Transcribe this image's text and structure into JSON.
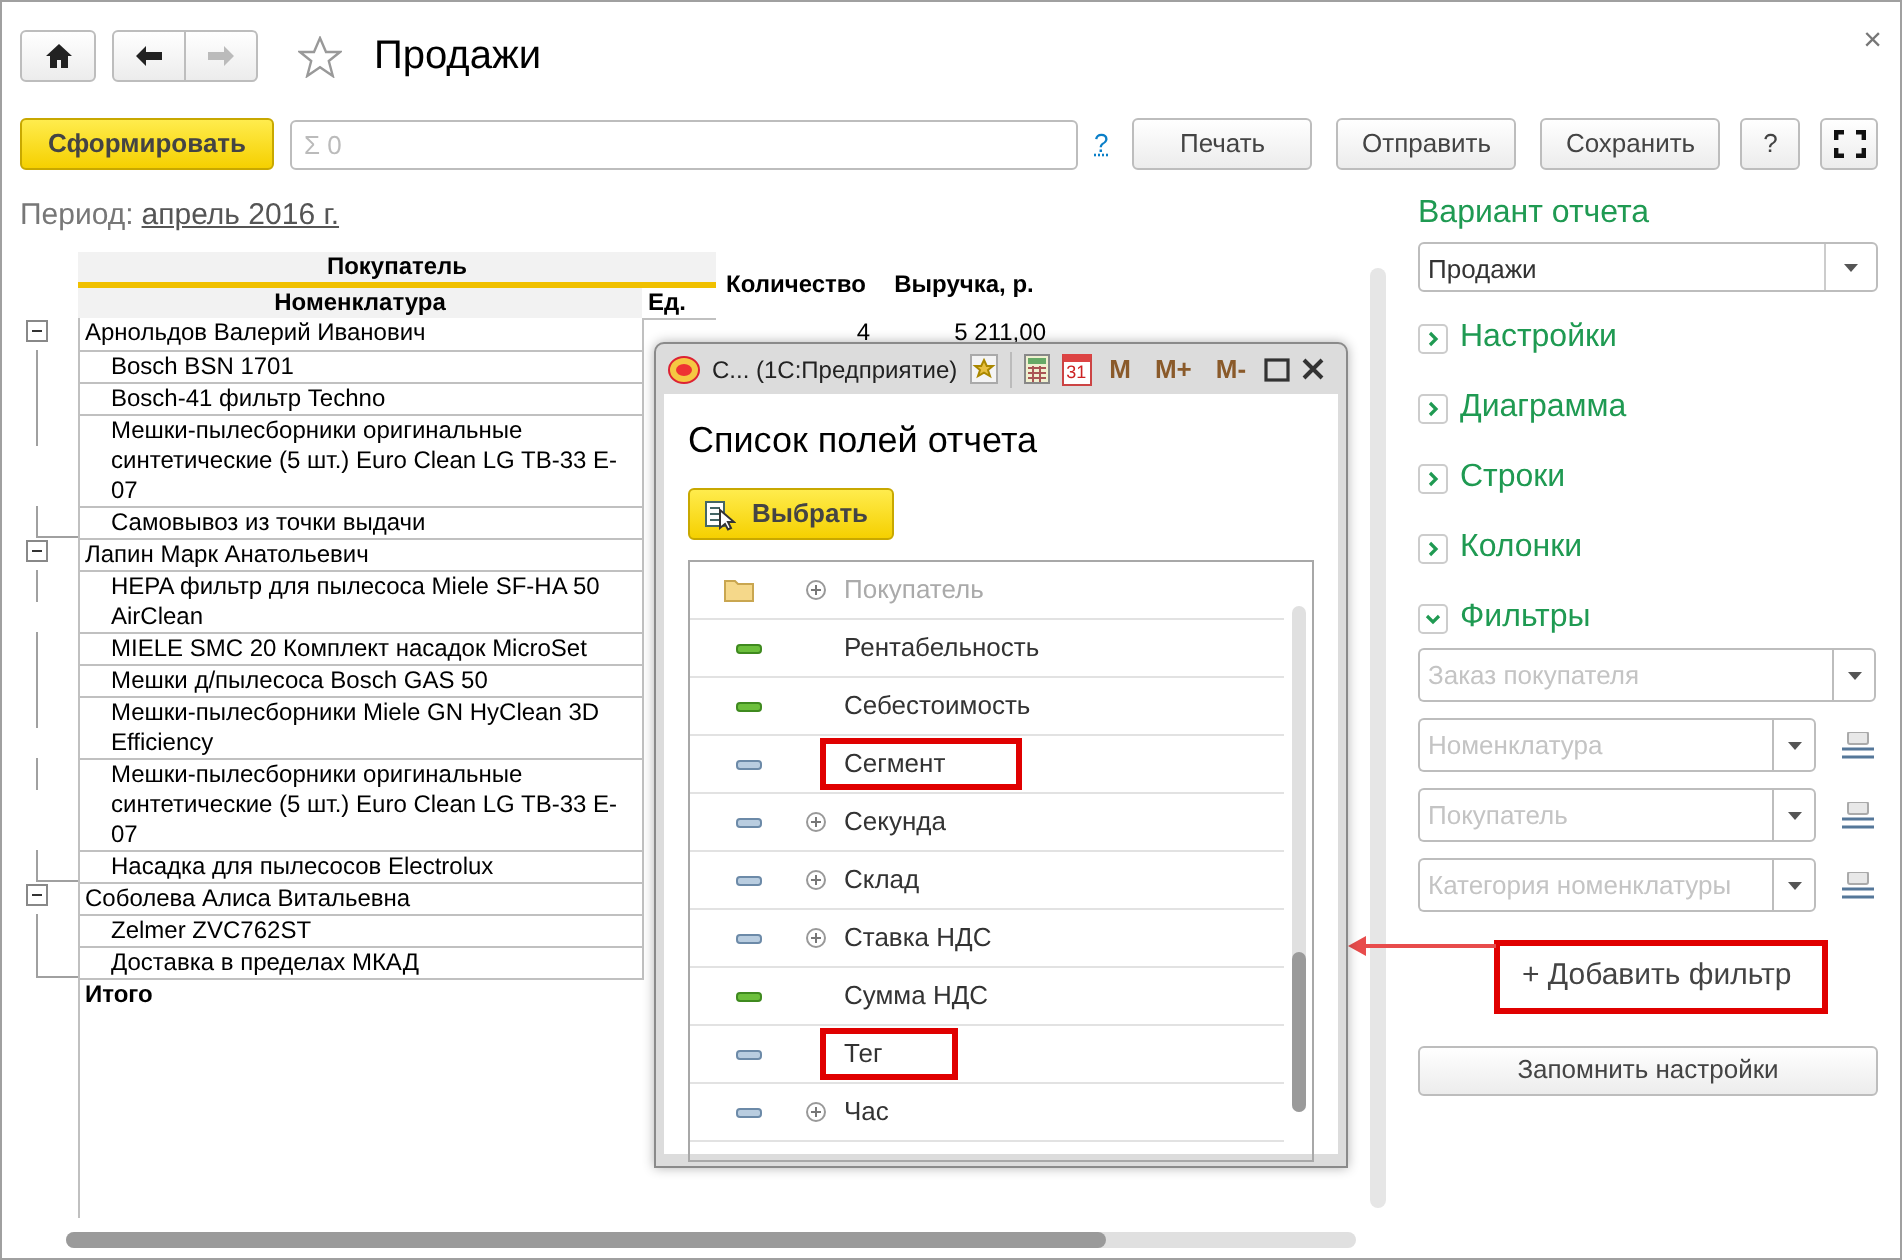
{
  "nav": {
    "back_disabled": false,
    "forward_disabled": true
  },
  "page": {
    "title": "Продажи",
    "favorite": false,
    "close_button": "×"
  },
  "toolbar": {
    "generate_button": "Сформировать",
    "search": {
      "placeholder": "Σ 0"
    },
    "help_link": "?",
    "buttons": [
      "Печать",
      "Отправить",
      "Сохранить"
    ],
    "help_button": "?"
  },
  "period": {
    "label": "Период:",
    "value": "апрель 2016 г."
  },
  "report": {
    "header": {
      "group": "Покупатель",
      "item": "Номенклатура",
      "unit": "Ед.",
      "quantity": "Количество",
      "revenue": "Выручка, р."
    },
    "groups": [
      {
        "name": "Арнольдов Валерий Иванович",
        "expanded": true,
        "quantity": "4",
        "revenue": "5 211,00",
        "children": [
          {
            "name": "Bosch BSN 1701"
          },
          {
            "name": "Bosch-41 фильтр Techno"
          },
          {
            "name": "Мешки-пылесборники оригинальные синтетические (5 шт.) Euro Clean LG TB-33 E-07"
          },
          {
            "name": "Самовывоз из точки выдачи"
          }
        ]
      },
      {
        "name": "Лапин Марк Анатольевич",
        "expanded": true,
        "children": [
          {
            "name": "HEPA фильтр для пылесоса Miele SF-HA 50 AirClean"
          },
          {
            "name": "MIELE SMC 20 Комплект насадок MicroSet"
          },
          {
            "name": "Мешки д/пылесоса Bosch GAS 50"
          },
          {
            "name": "Мешки-пылесборники Miele GN HyClean 3D Efficiency"
          },
          {
            "name": "Мешки-пылесборники оригинальные синтетические (5 шт.) Euro Clean LG TB-33 E-07"
          },
          {
            "name": "Насадка для пылесосов Electrolux"
          }
        ]
      },
      {
        "name": "Соболева Алиса Витальевна",
        "expanded": true,
        "children": [
          {
            "name": "Zelmer ZVC762ST"
          },
          {
            "name": "Доставка в пределах МКАД"
          }
        ]
      }
    ],
    "total": "Итого"
  },
  "settings_panel": {
    "variant_label": "Вариант отчета",
    "variant_value": "Продажи",
    "sections": [
      {
        "label": "Настройки",
        "expanded": false
      },
      {
        "label": "Диаграмма",
        "expanded": false
      },
      {
        "label": "Строки",
        "expanded": false
      },
      {
        "label": "Колонки",
        "expanded": false
      },
      {
        "label": "Фильтры",
        "expanded": true
      }
    ],
    "filters": [
      {
        "placeholder": "Заказ покупателя",
        "kind": "plain"
      },
      {
        "placeholder": "Номенклатура",
        "kind": "grouped"
      },
      {
        "placeholder": "Покупатель",
        "kind": "grouped"
      },
      {
        "placeholder": "Категория номенклатуры",
        "kind": "grouped"
      }
    ],
    "add_filter": {
      "label": "+ Добавить фильтр",
      "highlighted": true
    },
    "save_settings_button": "Запомнить настройки"
  },
  "popup": {
    "title": "С... (1С:Предприятие)",
    "calendar_day": "31",
    "memory_buttons": [
      "M",
      "M+",
      "M-"
    ],
    "heading": "Список полей отчета",
    "select_button": "Выбрать",
    "fields": [
      {
        "label": "Покупатель",
        "kind": "folder",
        "expandable": true,
        "disabled": true,
        "highlighted": false
      },
      {
        "label": "Рентабельность",
        "kind": "resource",
        "expandable": false,
        "disabled": false,
        "highlighted": false
      },
      {
        "label": "Себестоимость",
        "kind": "resource",
        "expandable": false,
        "disabled": false,
        "highlighted": false
      },
      {
        "label": "Сегмент",
        "kind": "dimension",
        "expandable": false,
        "disabled": false,
        "highlighted": true
      },
      {
        "label": "Секунда",
        "kind": "dimension",
        "expandable": true,
        "disabled": false,
        "highlighted": false
      },
      {
        "label": "Склад",
        "kind": "dimension",
        "expandable": true,
        "disabled": false,
        "highlighted": false
      },
      {
        "label": "Ставка НДС",
        "kind": "dimension",
        "expandable": true,
        "disabled": false,
        "highlighted": false
      },
      {
        "label": "Сумма НДС",
        "kind": "resource",
        "expandable": false,
        "disabled": false,
        "highlighted": false
      },
      {
        "label": "Тег",
        "kind": "dimension",
        "expandable": false,
        "disabled": false,
        "highlighted": true
      },
      {
        "label": "Час",
        "kind": "dimension",
        "expandable": true,
        "disabled": false,
        "highlighted": false
      }
    ]
  }
}
